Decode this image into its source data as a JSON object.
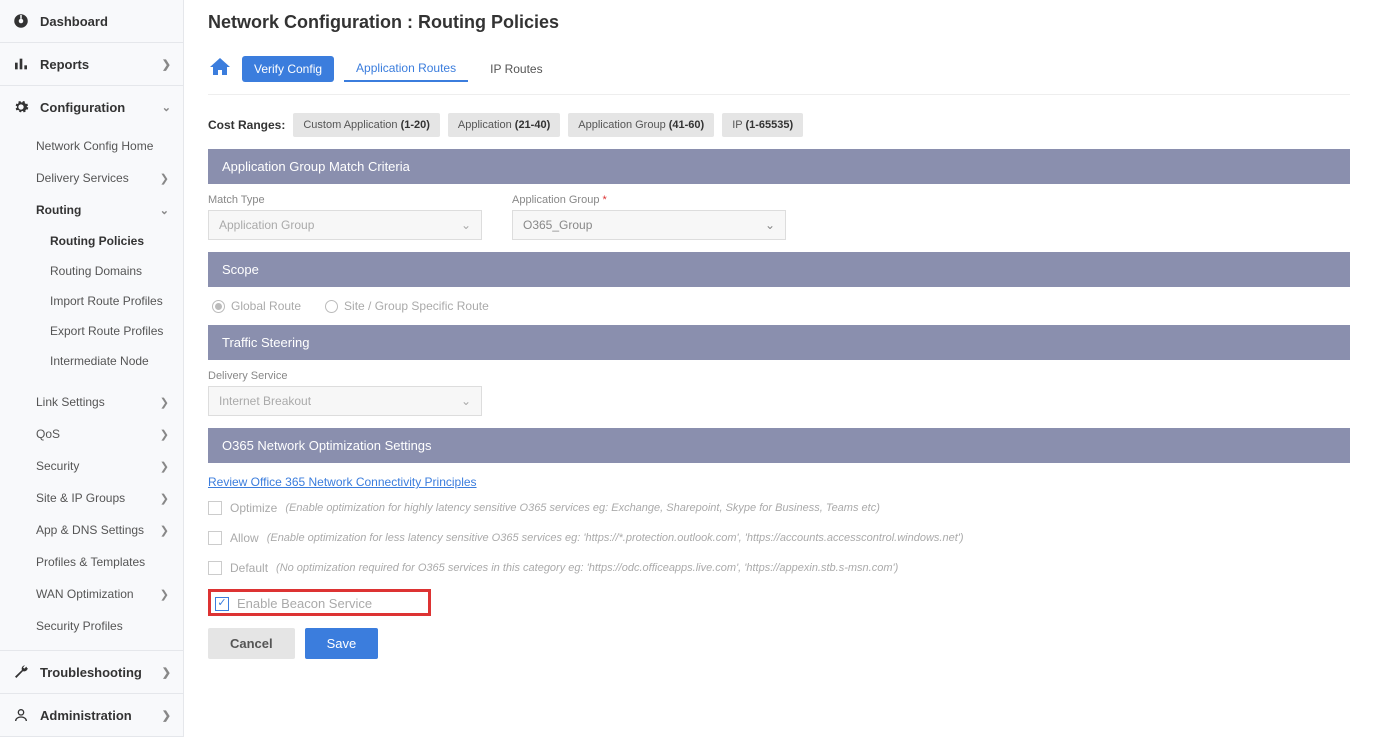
{
  "sidebar": {
    "dashboard": "Dashboard",
    "reports": "Reports",
    "configuration": "Configuration",
    "config_items": {
      "network_home": "Network Config Home",
      "delivery_services": "Delivery Services",
      "routing": "Routing",
      "routing_sub": {
        "policies": "Routing Policies",
        "domains": "Routing Domains",
        "import": "Import Route Profiles",
        "export": "Export Route Profiles",
        "intermediate": "Intermediate Node"
      },
      "link_settings": "Link Settings",
      "qos": "QoS",
      "security": "Security",
      "site_ip": "Site & IP Groups",
      "app_dns": "App & DNS Settings",
      "profiles": "Profiles & Templates",
      "wan_opt": "WAN Optimization",
      "sec_profiles": "Security Profiles"
    },
    "troubleshooting": "Troubleshooting",
    "administration": "Administration"
  },
  "page": {
    "title": "Network Configuration : Routing Policies"
  },
  "tabs": {
    "verify": "Verify Config",
    "app_routes": "Application Routes",
    "ip_routes": "IP Routes"
  },
  "cost": {
    "label": "Cost Ranges:",
    "custom_app": "Custom Application ",
    "custom_app_r": "(1-20)",
    "app": "Application ",
    "app_r": "(21-40)",
    "app_group": "Application Group ",
    "app_group_r": "(41-60)",
    "ip": "IP ",
    "ip_r": "(1-65535)"
  },
  "sections": {
    "match": "Application Group Match Criteria",
    "scope": "Scope",
    "steering": "Traffic Steering",
    "o365": "O365 Network Optimization Settings"
  },
  "match": {
    "type_label": "Match Type",
    "type_value": "Application Group",
    "group_label": "Application Group",
    "group_value": "O365_Group"
  },
  "scope": {
    "global": "Global Route",
    "site": "Site / Group Specific Route"
  },
  "steering": {
    "ds_label": "Delivery Service",
    "ds_value": "Internet Breakout"
  },
  "o365": {
    "link": "Review Office 365 Network Connectivity Principles",
    "optimize": "Optimize",
    "optimize_hint": "(Enable optimization for highly latency sensitive O365 services eg: Exchange, Sharepoint, Skype for Business, Teams etc)",
    "allow": "Allow",
    "allow_hint": "(Enable optimization for less latency sensitive O365 services eg: 'https://*.protection.outlook.com', 'https://accounts.accesscontrol.windows.net')",
    "default": "Default",
    "default_hint": "(No optimization required for O365 services in this category eg: 'https://odc.officeapps.live.com', 'https://appexin.stb.s-msn.com')",
    "beacon": "Enable Beacon Service"
  },
  "buttons": {
    "cancel": "Cancel",
    "save": "Save"
  }
}
